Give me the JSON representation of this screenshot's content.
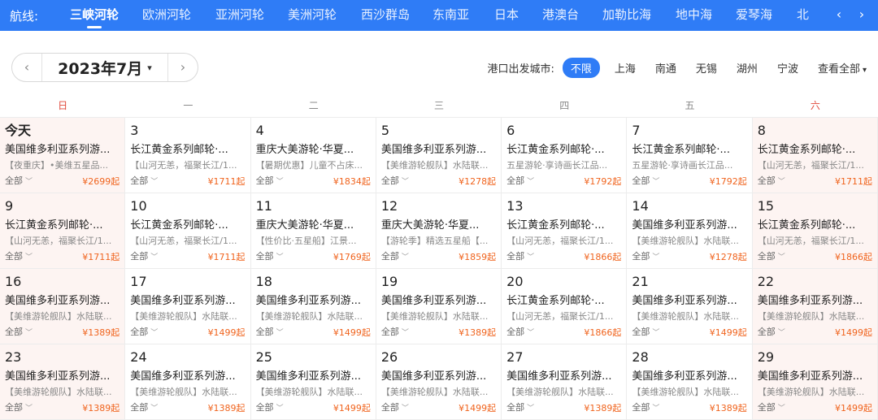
{
  "routebar": {
    "label": "航线:",
    "routes": [
      "三峡河轮",
      "欧洲河轮",
      "亚洲河轮",
      "美洲河轮",
      "西沙群岛",
      "东南亚",
      "日本",
      "港澳台",
      "加勒比海",
      "地中海",
      "爱琴海",
      "北"
    ],
    "active_index": 0,
    "prev_icon": "‹",
    "next_icon": "›"
  },
  "month": {
    "prev": "‹",
    "label": "2023年7月",
    "caret": "▾",
    "next": "›"
  },
  "port": {
    "label": "港口出发城市:",
    "cities": [
      "不限",
      "上海",
      "南通",
      "无锡",
      "湖州",
      "宁波"
    ],
    "selected_index": 0,
    "all_label": "查看全部",
    "caret": "▾"
  },
  "weekdays": [
    "日",
    "一",
    "二",
    "三",
    "四",
    "五",
    "六"
  ],
  "all_label": "全部",
  "cells": [
    {
      "day": "今天",
      "title": "美国维多利亚系列游...",
      "sub": "【夜重庆】•美维五星品...",
      "price": "¥2699起"
    },
    {
      "day": "3",
      "title": "长江黄金系列邮轮·...",
      "sub": "【山河无恙，福聚长江/1...",
      "price": "¥1711起"
    },
    {
      "day": "4",
      "title": "重庆大美游轮·华夏...",
      "sub": "【暑期优惠】儿童不占床...",
      "price": "¥1834起"
    },
    {
      "day": "5",
      "title": "美国维多利亚系列游...",
      "sub": "【美维游轮舰队】水陆联...",
      "price": "¥1278起"
    },
    {
      "day": "6",
      "title": "长江黄金系列邮轮·...",
      "sub": "五星游轮·享诗画长江品...",
      "price": "¥1792起"
    },
    {
      "day": "7",
      "title": "长江黄金系列邮轮·...",
      "sub": "五星游轮·享诗画长江品...",
      "price": "¥1792起"
    },
    {
      "day": "8",
      "title": "长江黄金系列邮轮·...",
      "sub": "【山河无恙，福聚长江/1...",
      "price": "¥1711起"
    },
    {
      "day": "9",
      "title": "长江黄金系列邮轮·...",
      "sub": "【山河无恙，福聚长江/1...",
      "price": "¥1711起"
    },
    {
      "day": "10",
      "title": "长江黄金系列邮轮·...",
      "sub": "【山河无恙，福聚长江/1...",
      "price": "¥1711起"
    },
    {
      "day": "11",
      "title": "重庆大美游轮·华夏...",
      "sub": "【性价比·五星船】江景...",
      "price": "¥1769起"
    },
    {
      "day": "12",
      "title": "重庆大美游轮·华夏...",
      "sub": "【游轮季】精选五星船【...",
      "price": "¥1859起"
    },
    {
      "day": "13",
      "title": "长江黄金系列邮轮·...",
      "sub": "【山河无恙，福聚长江/1...",
      "price": "¥1866起"
    },
    {
      "day": "14",
      "title": "美国维多利亚系列游...",
      "sub": "【美维游轮舰队】水陆联...",
      "price": "¥1278起"
    },
    {
      "day": "15",
      "title": "长江黄金系列邮轮·...",
      "sub": "【山河无恙，福聚长江/1...",
      "price": "¥1866起"
    },
    {
      "day": "16",
      "title": "美国维多利亚系列游...",
      "sub": "【美维游轮舰队】水陆联...",
      "price": "¥1389起"
    },
    {
      "day": "17",
      "title": "美国维多利亚系列游...",
      "sub": "【美维游轮舰队】水陆联...",
      "price": "¥1499起"
    },
    {
      "day": "18",
      "title": "美国维多利亚系列游...",
      "sub": "【美维游轮舰队】水陆联...",
      "price": "¥1499起"
    },
    {
      "day": "19",
      "title": "美国维多利亚系列游...",
      "sub": "【美维游轮舰队】水陆联...",
      "price": "¥1389起"
    },
    {
      "day": "20",
      "title": "长江黄金系列邮轮·...",
      "sub": "【山河无恙，福聚长江/1...",
      "price": "¥1866起"
    },
    {
      "day": "21",
      "title": "美国维多利亚系列游...",
      "sub": "【美维游轮舰队】水陆联...",
      "price": "¥1499起"
    },
    {
      "day": "22",
      "title": "美国维多利亚系列游...",
      "sub": "【美维游轮舰队】水陆联...",
      "price": "¥1499起"
    },
    {
      "day": "23",
      "title": "美国维多利亚系列游...",
      "sub": "【美维游轮舰队】水陆联...",
      "price": "¥1389起"
    },
    {
      "day": "24",
      "title": "美国维多利亚系列游...",
      "sub": "【美维游轮舰队】水陆联...",
      "price": "¥1389起"
    },
    {
      "day": "25",
      "title": "美国维多利亚系列游...",
      "sub": "【美维游轮舰队】水陆联...",
      "price": "¥1499起"
    },
    {
      "day": "26",
      "title": "美国维多利亚系列游...",
      "sub": "【美维游轮舰队】水陆联...",
      "price": "¥1499起"
    },
    {
      "day": "27",
      "title": "美国维多利亚系列游...",
      "sub": "【美维游轮舰队】水陆联...",
      "price": "¥1389起"
    },
    {
      "day": "28",
      "title": "美国维多利亚系列游...",
      "sub": "【美维游轮舰队】水陆联...",
      "price": "¥1389起"
    },
    {
      "day": "29",
      "title": "美国维多利亚系列游...",
      "sub": "【美维游轮舰队】水陆联...",
      "price": "¥1499起"
    }
  ],
  "colors": {
    "accent": "#2f7cf6",
    "price": "#f0641e",
    "weekend_header": "#e0483a",
    "weekend_bg": "#fdf4f2"
  }
}
